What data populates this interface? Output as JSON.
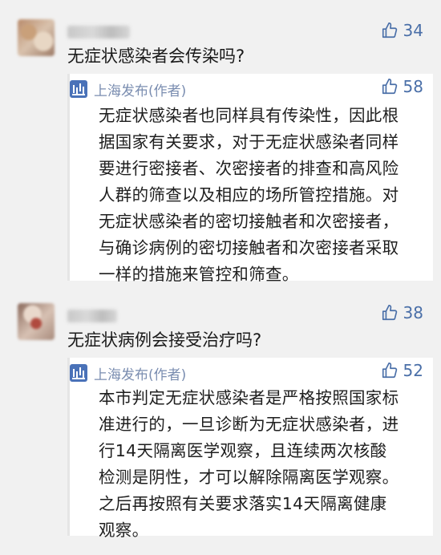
{
  "comments": [
    {
      "like_count": "34",
      "question": "无症状感染者会传染吗?",
      "reply": {
        "author": "上海发布(作者)",
        "like_count": "58",
        "lines": [
          "无症状感染者也同样具有传染性，因此根",
          "据国家有关要求，对于无症状感染者同样",
          "要进行密接者、次密接者的排查和高风险",
          "人群的筛查以及相应的场所管控措施。对",
          "无症状感染者的密切接触者和次密接者，",
          "与确诊病例的密切接触者和次密接者采取",
          "一样的措施来管控和筛查。"
        ]
      }
    },
    {
      "like_count": "38",
      "question": "无症状病例会接受治疗吗?",
      "reply": {
        "author": "上海发布(作者)",
        "like_count": "52",
        "lines": [
          "本市判定无症状感染者是严格按照国家标",
          "准进行的，一旦诊断为无症状感染者，进",
          "行14天隔离医学观察，且连续两次核酸",
          "检测是阴性，才可以解除隔离医学观察。",
          "之后再按照有关要求落实14天隔离健康",
          "观察。"
        ]
      }
    }
  ],
  "colors": {
    "like_blue": "#4a6fa8",
    "author_name": "#7a8db0",
    "logo_blue": "#4a72b8"
  }
}
